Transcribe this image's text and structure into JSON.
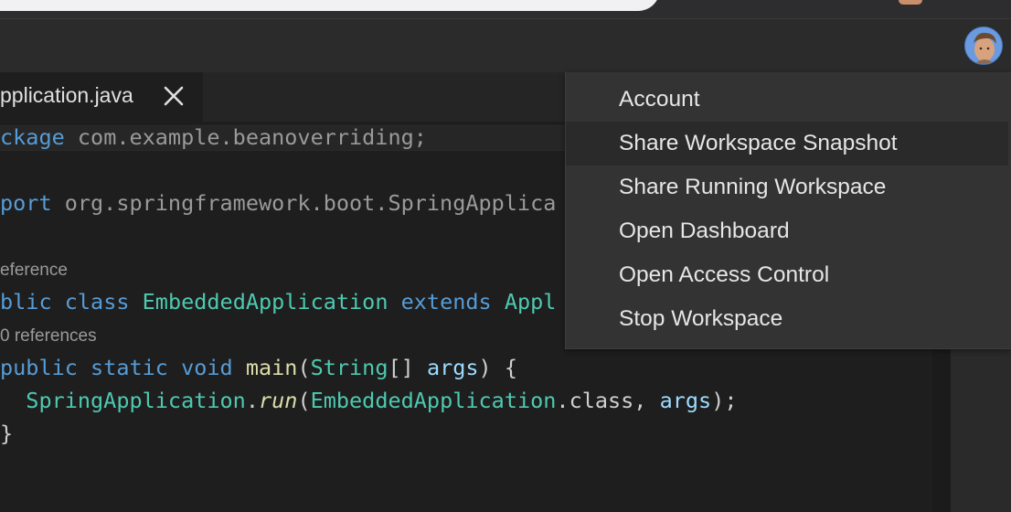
{
  "editor_tab": {
    "label": "pplication.java",
    "close_icon": "close-icon"
  },
  "code": {
    "line1": {
      "keyword": "ckage",
      "rest": " com.example.beanoverriding;"
    },
    "line2": {
      "keyword": "port",
      "rest": " org.springframework.boot.SpringApplica"
    },
    "lens1": "eference",
    "line3": {
      "kw1": "blic",
      "kw2": "class",
      "type": "EmbeddedApplication",
      "kw3": "extends",
      "type2": "Appl"
    },
    "lens2": "0 references",
    "line4": {
      "kw1": "public",
      "kw2": "static",
      "kw3": "void",
      "fn": "main",
      "p1": "(",
      "type": "String",
      "p2": "[] ",
      "param": "args",
      "p3": ") {"
    },
    "line5": {
      "type": "SpringApplication",
      "dot": ".",
      "fn": "run",
      "p1": "(",
      "type2": "EmbeddedApplication",
      "p2": ".class, ",
      "param": "args",
      "p3": ");"
    },
    "line6": "}"
  },
  "menu": {
    "items": [
      {
        "label": "Account"
      },
      {
        "label": "Share Workspace Snapshot"
      },
      {
        "label": "Share Running Workspace"
      },
      {
        "label": "Open Dashboard"
      },
      {
        "label": "Open Access Control"
      },
      {
        "label": "Stop Workspace"
      }
    ],
    "highlighted_index": 1
  },
  "header": {
    "avatar_icon": "user-avatar"
  },
  "colors": {
    "keyword": "#569cd6",
    "type": "#4ec9b0",
    "function": "#dcdcaa",
    "parameter": "#9cdcfe",
    "menu_bg": "#333333",
    "editor_bg": "#1e1e1e"
  }
}
